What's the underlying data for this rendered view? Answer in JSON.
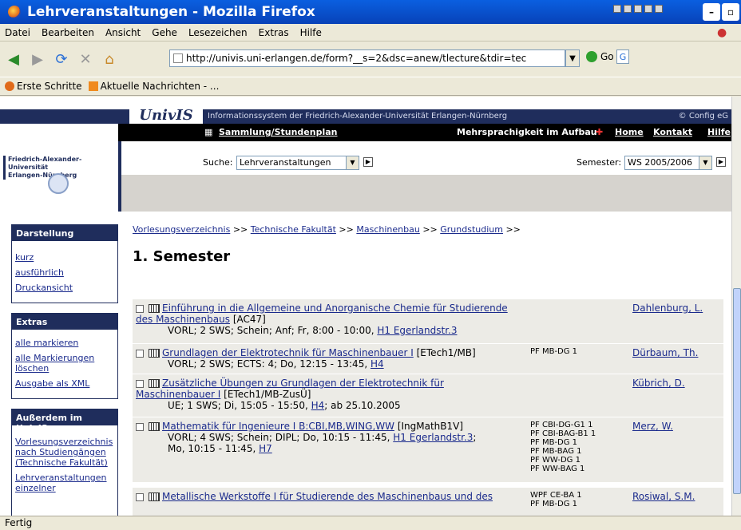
{
  "window": {
    "title": "Lehrveranstaltungen - Mozilla Firefox"
  },
  "menu": [
    "Datei",
    "Bearbeiten",
    "Ansicht",
    "Gehe",
    "Lesezeichen",
    "Extras",
    "Hilfe"
  ],
  "nav": {
    "url": "http://univis.uni-erlangen.de/form?__s=2&dsc=anew/tlecture&tdir=tec",
    "go": "Go"
  },
  "bookmarks": [
    "Erste Schritte",
    "Aktuelle Nachrichten - ..."
  ],
  "univis": {
    "logo": "UnivIS",
    "tagline": "Informationssystem der Friedrich-Alexander-Universität Erlangen-Nürnberg",
    "config": "© Config eG",
    "collection": "Sammlung/Stundenplan",
    "multilang": "Mehrsprachigkeit im Aufbau",
    "home": "Home",
    "contact": "Kontakt",
    "help": "Hilfe",
    "university": "Friedrich-Alexander-Universität\nErlangen-Nürnberg",
    "search_label": "Suche:",
    "search_value": "Lehrveranstaltungen",
    "semester_label": "Semester:",
    "semester_value": "WS 2005/2006"
  },
  "sidebar": {
    "darstellung": {
      "title": "Darstellung",
      "links": [
        "kurz",
        "ausführlich",
        "Druckansicht"
      ]
    },
    "extras": {
      "title": "Extras",
      "links": [
        "alle markieren",
        "alle Markierungen löschen",
        "Ausgabe als XML"
      ]
    },
    "ausserdem": {
      "title": "Außerdem im UnivIS",
      "links": [
        "Vorlesungsverzeichnis nach Studiengängen (Technische Fakultät)",
        "Lehrveranstaltungen einzelner"
      ]
    }
  },
  "breadcrumb": {
    "items": [
      "Vorlesungsverzeichnis",
      "Technische Fakultät",
      "Maschinenbau",
      "Grundstudium"
    ],
    "sep": ">>"
  },
  "page_title": "1. Semester",
  "courses": [
    {
      "link": "Einführung in die Allgemeine und Anorganische Chemie für Studierende des Maschinenbaus",
      "code": "[AC47]",
      "details": "VORL; 2 SWS; Schein; Anf; Fr, 8:00 - 10:00,",
      "room": "H1 Egerlandstr.3",
      "modules": "",
      "lecturer": "Dahlenburg, L."
    },
    {
      "link": "Grundlagen der Elektrotechnik für Maschinenbauer I",
      "code": "[ETech1/MB]",
      "details": "VORL; 2 SWS; ECTS: 4; Do, 12:15 - 13:45,",
      "room": "H4",
      "modules": "PF MB-DG 1",
      "lecturer": "Dürbaum, Th."
    },
    {
      "link": "Zusätzliche Übungen zu Grundlagen der Elektrotechnik für Maschinenbauer I",
      "code": "[ETech1/MB-ZusÜ]",
      "details": "UE; 1 SWS; Di, 15:05 - 15:50,",
      "room": "H4",
      "extra": "; ab 25.10.2005",
      "modules": "",
      "lecturer": "Kübrich, D."
    },
    {
      "link": "Mathematik für Ingenieure I B:CBI,MB,WING,WW",
      "code": "[IngMathB1V]",
      "details": "VORL; 4 SWS; Schein; DIPL; Do, 10:15 - 11:45,",
      "room": "H1 Egerlandstr.3",
      "details2": "Mo, 10:15 - 11:45,",
      "room2": "H7",
      "modules": "PF CBI-DG-G1 1\nPF CBI-BAG-B1 1\nPF MB-DG 1\nPF MB-BAG 1\nPF WW-DG 1\nPF WW-BAG 1",
      "lecturer": "Merz, W."
    },
    {
      "link": "Metallische Werkstoffe I für Studierende des Maschinenbaus und des",
      "code": "",
      "details": "",
      "room": "",
      "modules": "WPF CE-BA 1\nPF MB-DG 1",
      "lecturer": "Rosiwal, S.M."
    }
  ],
  "status": "Fertig"
}
